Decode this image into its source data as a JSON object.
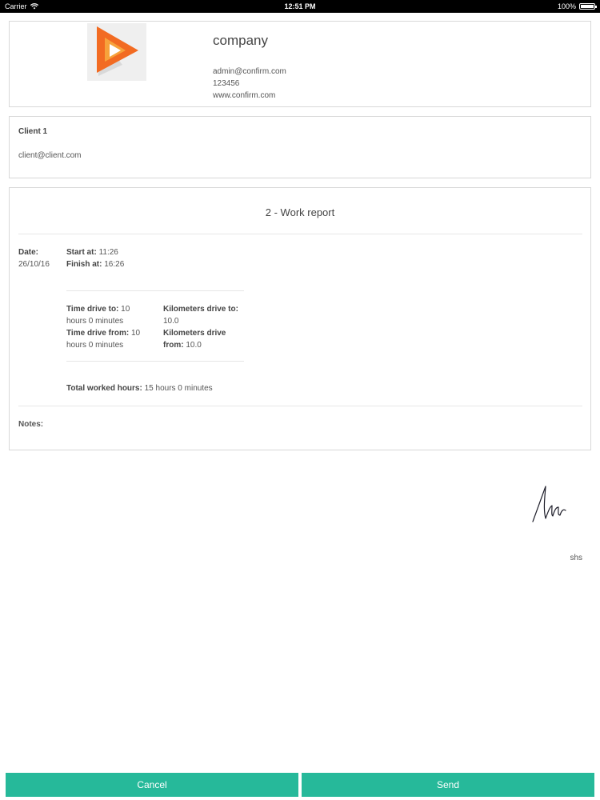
{
  "status_bar": {
    "carrier": "Carrier",
    "time": "12:51 PM",
    "battery": "100%",
    "battery_level": 1.0
  },
  "company": {
    "name": "company",
    "email": "admin@confirm.com",
    "phone": "123456",
    "website": "www.confirm.com"
  },
  "client": {
    "name": "Client 1",
    "email": "client@client.com"
  },
  "report": {
    "title": "2 - Work report",
    "date_label": "Date:",
    "date_value": "26/10/16",
    "start_label": "Start at:",
    "start_value": "11:26",
    "finish_label": "Finish at:",
    "finish_value": "16:26",
    "drive_to_label": "Time drive to:",
    "drive_to_value": "10",
    "drive_to_value2": "hours 0 minutes",
    "drive_from_label": "Time drive from:",
    "drive_from_value": "10",
    "drive_from_value2": "hours 0 minutes",
    "km_to_label": "Kilometers drive to:",
    "km_to_value": "10.0",
    "km_from_label": "Kilometers drive",
    "km_from_label2": "from:",
    "km_from_value": "10.0",
    "total_label": "Total worked hours:",
    "total_value": "15 hours 0 minutes",
    "notes_label": "Notes:"
  },
  "signature": {
    "name": "shs"
  },
  "actions": {
    "cancel_label": "Cancel",
    "send_label": "Send"
  },
  "colors": {
    "accent": "#26b99a",
    "logo_orange": "#f26b22"
  }
}
